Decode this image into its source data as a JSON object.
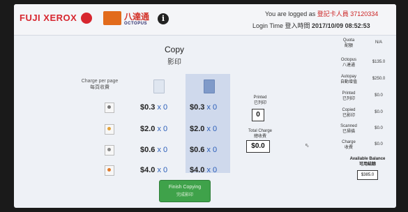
{
  "header": {
    "brand": "FUJI XEROX",
    "octopus_cn": "八達通",
    "octopus_en": "OCTOPUS",
    "info_glyph": "i",
    "logged_label": "You are logged as",
    "logged_user": "登記卡人員 37120334",
    "login_time_label": "Login Time 登入時間",
    "login_time_value": "2017/10/09 08:52:53"
  },
  "page": {
    "title": "Copy",
    "title_cn": "影印",
    "charge_per_page": "Charge per page\n每頁收費"
  },
  "rows": [
    {
      "col1_price": "$0.3",
      "col1_qty": "x 0",
      "col2_price": "$0.3",
      "col2_qty": "x 0",
      "dot_color": "#777777"
    },
    {
      "col1_price": "$2.0",
      "col1_qty": "x 0",
      "col2_price": "$2.0",
      "col2_qty": "x 0",
      "dot_color": "#e2a23a"
    },
    {
      "col1_price": "$0.6",
      "col1_qty": "x 0",
      "col2_price": "$0.6",
      "col2_qty": "x 0",
      "dot_color": "#888888"
    },
    {
      "col1_price": "$4.0",
      "col1_qty": "x 0",
      "col2_price": "$4.0",
      "col2_qty": "x 0",
      "dot_color": "#e07a2b"
    }
  ],
  "summary": {
    "printed_label": "Printed\n已列印",
    "printed_value": "0",
    "total_label": "Total Charge\n總收費",
    "total_value": "$0.0"
  },
  "sidebar": {
    "quota_label": "Quota\n配額",
    "quota_value": "N/A",
    "octopus_label": "Octopus\n八達通",
    "octopus_value": "$135.0",
    "autopay_label": "Autopay\n自動增值",
    "autopay_value": "$250.0",
    "printed_label": "Printed\n已列印",
    "printed_value": "$0.0",
    "copied_label": "Copied\n已影印",
    "copied_value": "$0.0",
    "scanned_label": "Scanned\n已掃描",
    "scanned_value": "$0.0",
    "charge_label": "Charge\n收費",
    "charge_value": "$0.0",
    "available_label": "Available Balance\n可用結餘",
    "available_value": "$385.0"
  },
  "actions": {
    "finish_label": "Finish Copying",
    "finish_label_cn": "完成影印"
  },
  "colors": {
    "brand_red": "#d7262f",
    "accent_blue": "#2a5db8",
    "finish_green": "#3fa24a",
    "selected_column": "#cfd9ec"
  }
}
